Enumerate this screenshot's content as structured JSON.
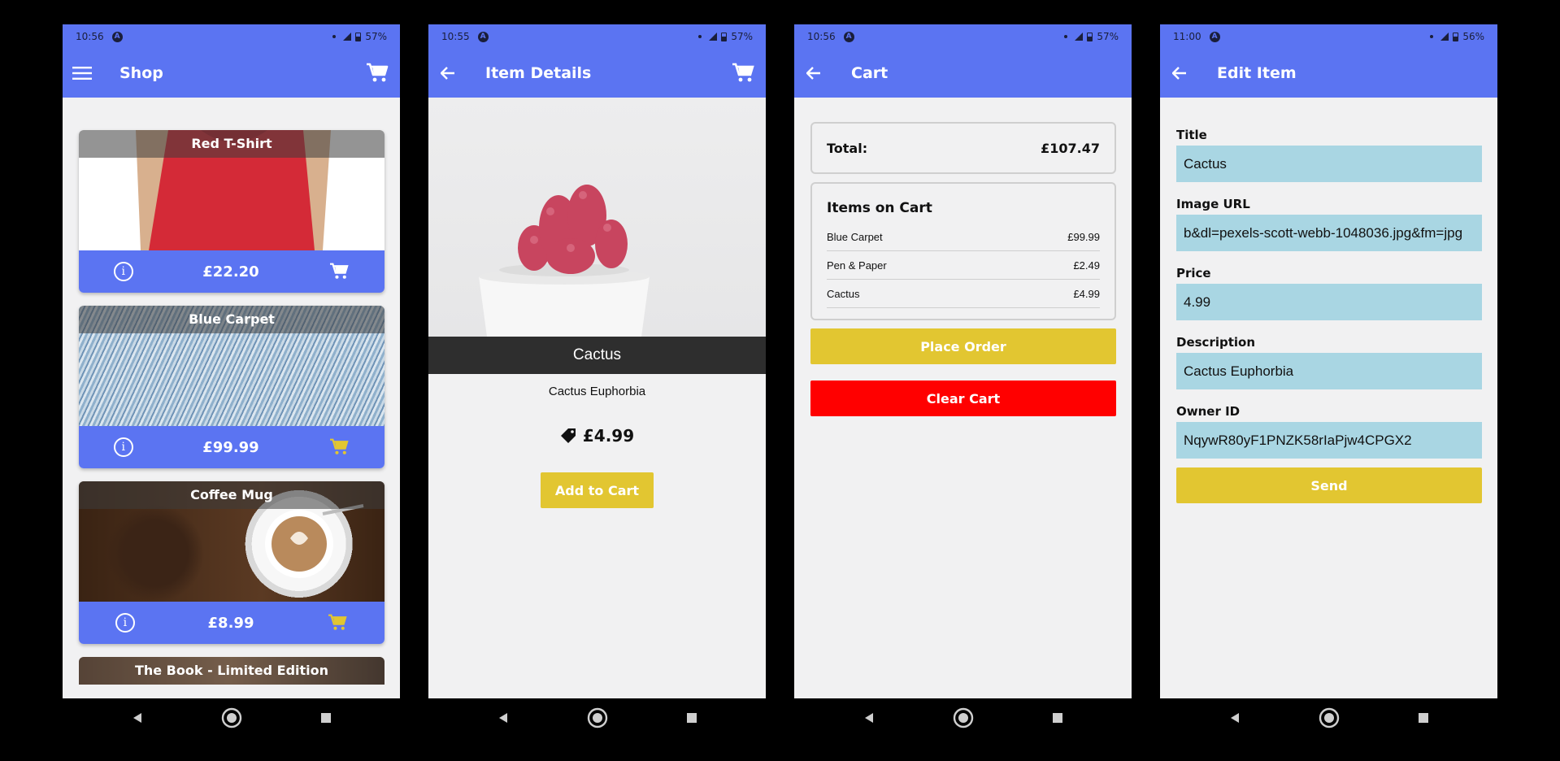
{
  "colors": {
    "primary": "#5b74f2",
    "accent": "#e2c631",
    "danger": "#ff0000",
    "field": "#a9d6e3",
    "background": "#f1f1f2"
  },
  "screens": {
    "shop": {
      "status": {
        "time": "10:56",
        "battery": "57%"
      },
      "title": "Shop",
      "nav_icon": "menu-icon",
      "products": [
        {
          "title": "Red T-Shirt",
          "price": "£22.20",
          "cart_icon_color": "#ffffff"
        },
        {
          "title": "Blue Carpet",
          "price": "£99.99",
          "cart_icon_color": "#e2c631"
        },
        {
          "title": "Coffee Mug",
          "price": "£8.99",
          "cart_icon_color": "#e2c631"
        }
      ],
      "partial_product": {
        "title": "The Book - Limited Edition"
      }
    },
    "details": {
      "status": {
        "time": "10:55",
        "battery": "57%"
      },
      "title": "Item Details",
      "nav_icon": "back-arrow-icon",
      "item_name": "Cactus",
      "description": "Cactus Euphorbia",
      "price": "£4.99",
      "add_button": "Add to Cart"
    },
    "cart": {
      "status": {
        "time": "10:56",
        "battery": "57%"
      },
      "title": "Cart",
      "nav_icon": "back-arrow-icon",
      "total_label": "Total:",
      "total_value": "£107.47",
      "items_heading": "Items on Cart",
      "items": [
        {
          "name": "Blue Carpet",
          "price": "£99.99"
        },
        {
          "name": "Pen & Paper",
          "price": "£2.49"
        },
        {
          "name": "Cactus",
          "price": "£4.99"
        }
      ],
      "place_order": "Place Order",
      "clear_cart": "Clear Cart"
    },
    "edit": {
      "status": {
        "time": "11:00",
        "battery": "56%"
      },
      "title": "Edit Item",
      "nav_icon": "back-arrow-icon",
      "fields": {
        "title_label": "Title",
        "title_value": "Cactus",
        "image_label": "Image URL",
        "image_value": "b&dl=pexels-scott-webb-1048036.jpg&fm=jpg",
        "price_label": "Price",
        "price_value": "4.99",
        "desc_label": "Description",
        "desc_value": "Cactus Euphorbia",
        "owner_label": "Owner ID",
        "owner_value": "NqywR80yF1PNZK58rIaPjw4CPGX2"
      },
      "send": "Send"
    }
  }
}
